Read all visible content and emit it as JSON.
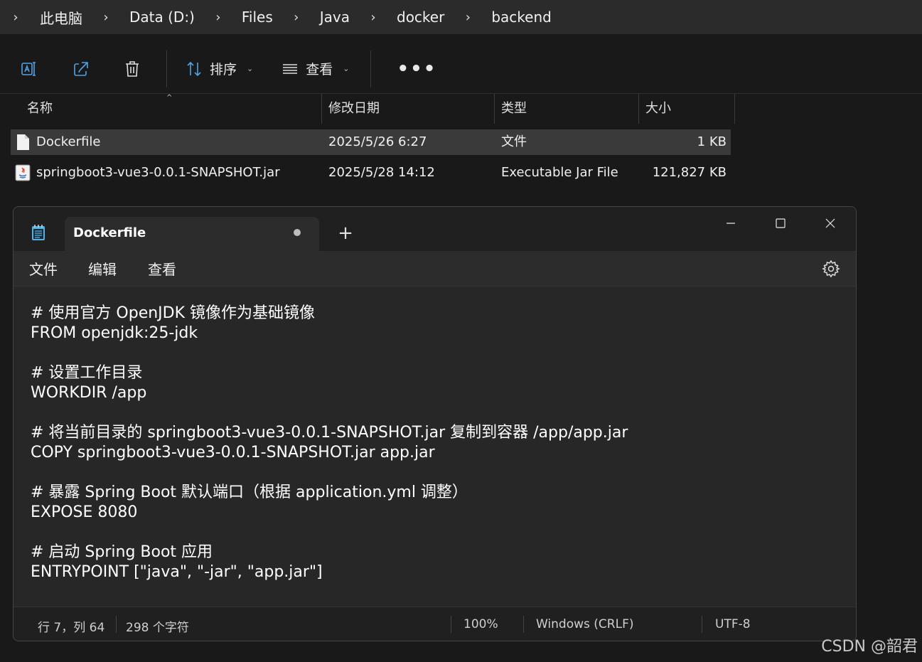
{
  "breadcrumb": {
    "items": [
      "此电脑",
      "Data (D:)",
      "Files",
      "Java",
      "docker",
      "backend"
    ]
  },
  "toolbar": {
    "sort_label": "排序",
    "view_label": "查看",
    "more_label": "•••"
  },
  "file_list": {
    "columns": [
      "名称",
      "修改日期",
      "类型",
      "大小"
    ],
    "rows": [
      {
        "name": "Dockerfile",
        "modified": "2025/5/26 6:27",
        "type": "文件",
        "size": "1 KB",
        "icon": "file-icon"
      },
      {
        "name": "springboot3-vue3-0.0.1-SNAPSHOT.jar",
        "modified": "2025/5/28 14:12",
        "type": "Executable Jar File",
        "size": "121,827 KB",
        "icon": "java-jar-icon"
      }
    ]
  },
  "notepad": {
    "tab_title": "Dockerfile",
    "new_tab_label": "+",
    "menu": [
      "文件",
      "编辑",
      "查看"
    ],
    "lines": [
      "# 使用官方 OpenJDK 镜像作为基础镜像",
      "FROM openjdk:25-jdk",
      "",
      "# 设置工作目录",
      "WORKDIR /app",
      "",
      "# 将当前目录的 springboot3-vue3-0.0.1-SNAPSHOT.jar 复制到容器 /app/app.jar",
      "COPY springboot3-vue3-0.0.1-SNAPSHOT.jar app.jar",
      "",
      "# 暴露 Spring Boot 默认端口（根据 application.yml 调整）",
      "EXPOSE 8080",
      "",
      "# 启动 Spring Boot 应用",
      "ENTRYPOINT [\"java\", \"-jar\", \"app.jar\"]"
    ],
    "status": {
      "position": "行 7，列 64",
      "char_count": "298 个字符",
      "zoom": "100%",
      "line_ending": "Windows (CRLF)",
      "encoding": "UTF-8"
    }
  },
  "watermark": "CSDN @韶君"
}
